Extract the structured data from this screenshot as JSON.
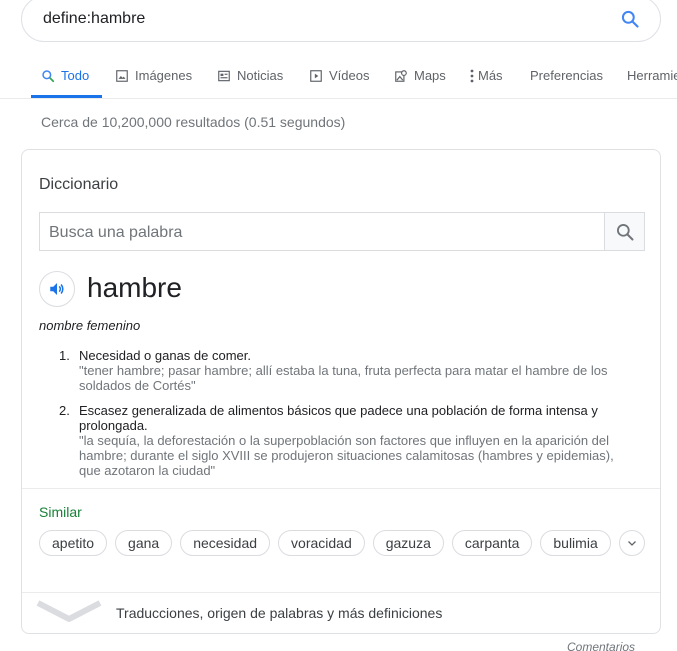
{
  "search": {
    "query": "define:hambre"
  },
  "tabs": [
    {
      "label": "Todo",
      "icon": "search-icon"
    },
    {
      "label": "Imágenes",
      "icon": "image-icon"
    },
    {
      "label": "Noticias",
      "icon": "news-icon"
    },
    {
      "label": "Vídeos",
      "icon": "video-icon"
    },
    {
      "label": "Maps",
      "icon": "map-icon"
    },
    {
      "label": "Más",
      "icon": "more-vert-icon"
    },
    {
      "label": "Preferencias"
    },
    {
      "label": "Herramientas"
    }
  ],
  "results_stats": "Cerca de 10,200,000 resultados (0.51 segundos)",
  "dictionary": {
    "title": "Diccionario",
    "search_placeholder": "Busca una palabra",
    "word": "hambre",
    "part_of_speech": "nombre femenino",
    "definitions": [
      {
        "num": "1.",
        "text": "Necesidad o ganas de comer.",
        "example": "\"tener hambre; pasar hambre; allí estaba la tuna, fruta perfecta para matar el hambre de los soldados de Cortés\""
      },
      {
        "num": "2.",
        "text": "Escasez generalizada de alimentos básicos que padece una población de forma intensa y prolongada.",
        "example": "\"la sequía, la deforestación o la superpoblación son factores que influyen en la aparición del hambre; durante el siglo XVIII se produjeron situaciones calamitosas (hambres y epidemias), que azotaron la ciudad\""
      }
    ],
    "similar_label": "Similar",
    "similar": [
      "apetito",
      "gana",
      "necesidad",
      "voracidad",
      "gazuza",
      "carpanta",
      "bulimia"
    ],
    "more_link": "Traducciones, origen de palabras y más definiciones"
  },
  "feedback": "Comentarios",
  "colors": {
    "accent": "#1a73e8",
    "similar_green": "#188038",
    "muted": "#70757a"
  }
}
